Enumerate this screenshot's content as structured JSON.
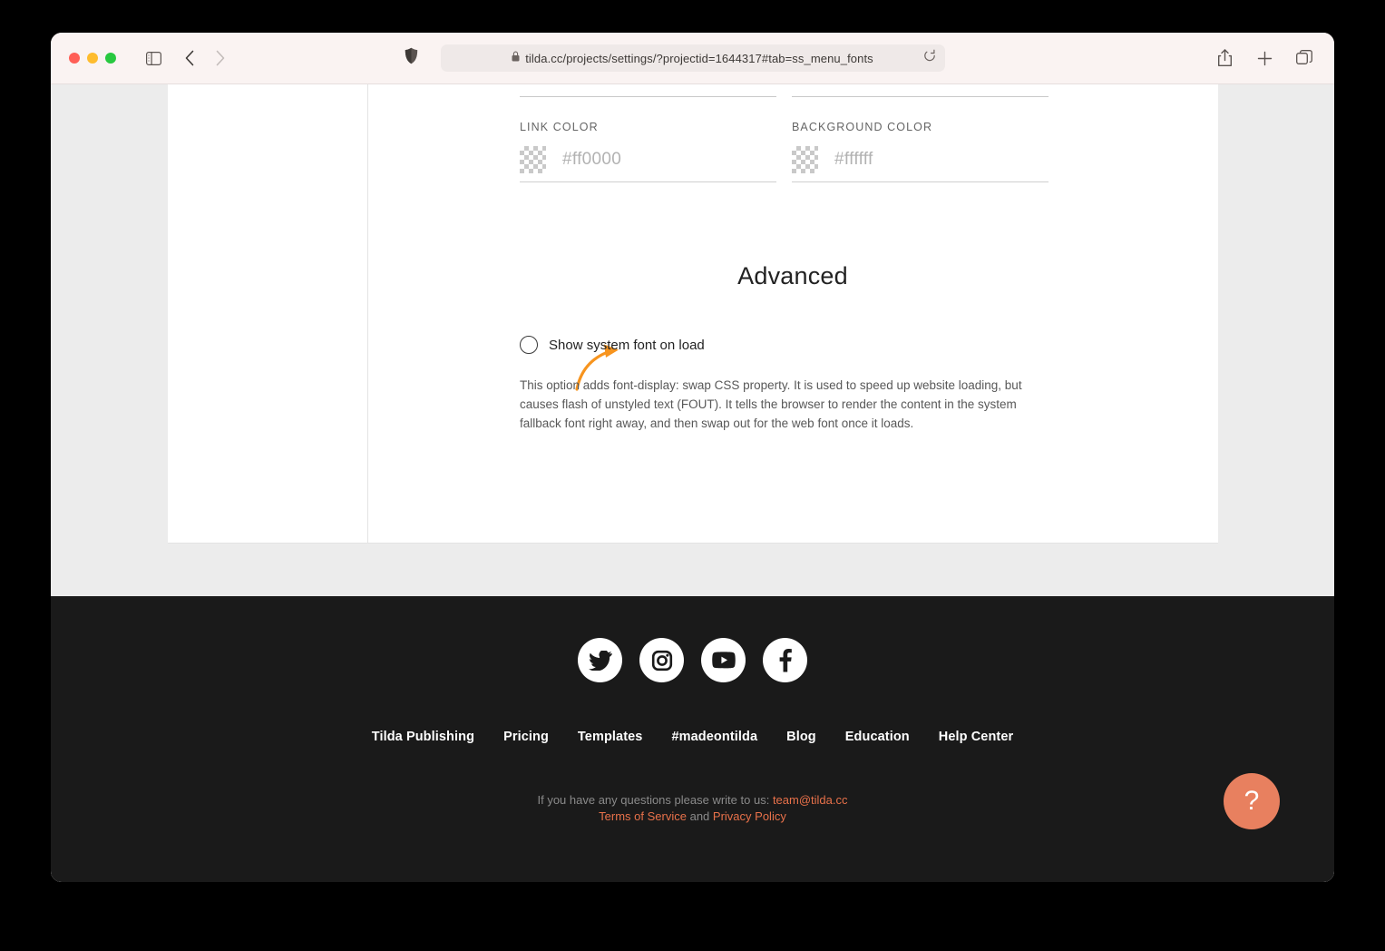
{
  "browser": {
    "window_controls": [
      {
        "name": "close",
        "color": "#ff5f57"
      },
      {
        "name": "minimize",
        "color": "#febc2e"
      },
      {
        "name": "maximize",
        "color": "#28c840"
      }
    ],
    "url": "tilda.cc/projects/settings/?projectid=1644317#tab=ss_menu_fonts",
    "icons": {
      "sidebar": "sidebar-toggle-icon",
      "back": "back-chevron-icon",
      "forward": "forward-chevron-icon",
      "shield": "privacy-shield-icon",
      "lock": "lock-icon",
      "reload": "reload-icon",
      "share": "share-icon",
      "new_tab": "plus-icon",
      "tabs": "tabs-overview-icon"
    }
  },
  "settings": {
    "link_color": {
      "label": "LINK COLOR",
      "value": "#ff0000"
    },
    "background_color": {
      "label": "BACKGROUND COLOR",
      "value": "#ffffff"
    },
    "advanced": {
      "heading": "Advanced",
      "option_label": "Show system font on load",
      "option_checked": false,
      "description": "This option adds font-display: swap CSS property. It is used to speed up website loading, but causes flash of unstyled text (FOUT). It tells the browser to render the content in the system fallback font right away, and then swap out for the web font once it loads."
    },
    "annotation": {
      "type": "arrow",
      "color": "#f7941e",
      "points_to": "show-system-font-on-load-radio"
    }
  },
  "footer": {
    "social": [
      {
        "name": "twitter-icon",
        "label": "Twitter"
      },
      {
        "name": "instagram-icon",
        "label": "Instagram"
      },
      {
        "name": "youtube-icon",
        "label": "YouTube"
      },
      {
        "name": "facebook-icon",
        "label": "Facebook"
      }
    ],
    "nav": [
      {
        "label": "Tilda Publishing"
      },
      {
        "label": "Pricing"
      },
      {
        "label": "Templates"
      },
      {
        "label": "#madeontilda"
      },
      {
        "label": "Blog"
      },
      {
        "label": "Education"
      },
      {
        "label": "Help Center"
      }
    ],
    "contact_prefix": "If you have any questions please write to us:",
    "contact_email": "team@tilda.cc",
    "terms_label": "Terms of Service",
    "and_label": "and",
    "privacy_label": "Privacy Policy",
    "accent_color": "#e8714a"
  },
  "help_button": {
    "glyph": "?",
    "color": "#e8805f"
  }
}
